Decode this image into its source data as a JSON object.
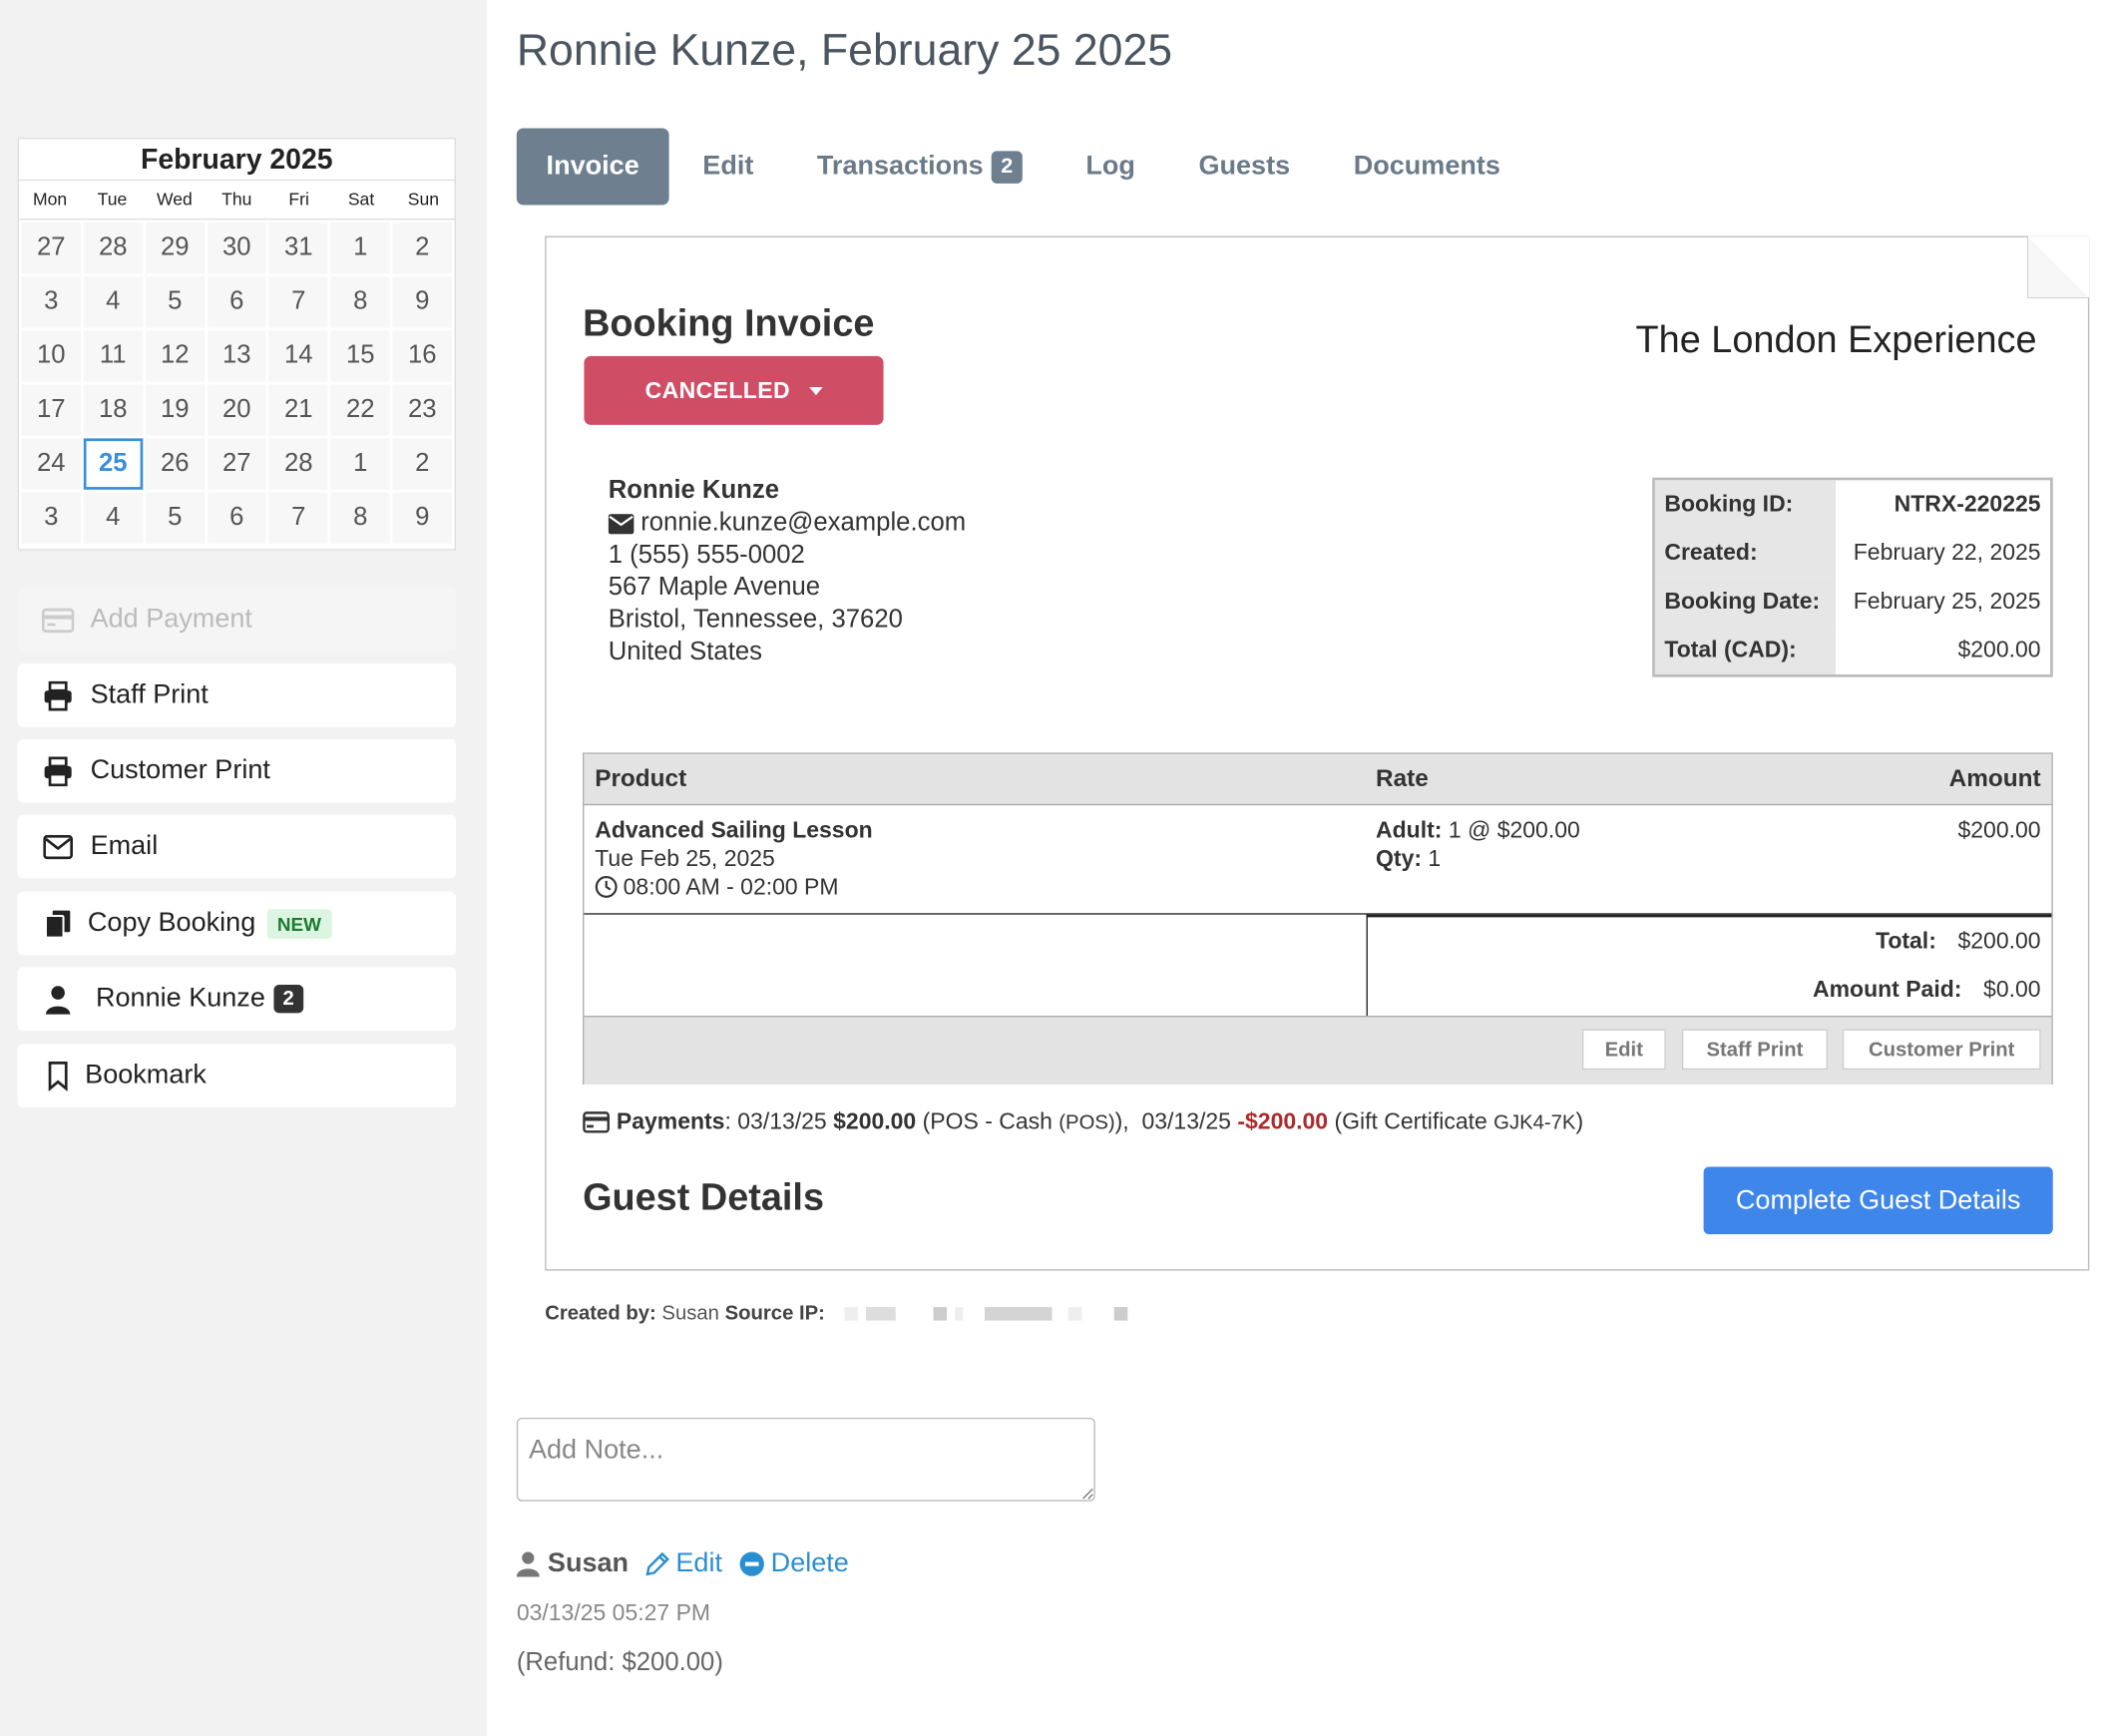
{
  "calendar": {
    "month_label": "February 2025",
    "weekdays": [
      "Mon",
      "Tue",
      "Wed",
      "Thu",
      "Fri",
      "Sat",
      "Sun"
    ],
    "days": [
      "27",
      "28",
      "29",
      "30",
      "31",
      "1",
      "2",
      "3",
      "4",
      "5",
      "6",
      "7",
      "8",
      "9",
      "10",
      "11",
      "12",
      "13",
      "14",
      "15",
      "16",
      "17",
      "18",
      "19",
      "20",
      "21",
      "22",
      "23",
      "24",
      "25",
      "26",
      "27",
      "28",
      "1",
      "2",
      "3",
      "4",
      "5",
      "6",
      "7",
      "8",
      "9"
    ],
    "selected_day": "25"
  },
  "sidebar": {
    "add_payment": "Add Payment",
    "staff_print": "Staff Print",
    "customer_print": "Customer Print",
    "email": "Email",
    "copy_booking": "Copy Booking",
    "copy_booking_badge": "NEW",
    "customer_name": "Ronnie Kunze",
    "customer_badge": "2",
    "bookmark": "Bookmark"
  },
  "page": {
    "title": "Ronnie Kunze, February 25 2025"
  },
  "tabs": [
    {
      "label": "Invoice",
      "active": true
    },
    {
      "label": "Edit"
    },
    {
      "label": "Transactions",
      "badge": "2"
    },
    {
      "label": "Log"
    },
    {
      "label": "Guests"
    },
    {
      "label": "Documents"
    }
  ],
  "invoice": {
    "title": "Booking Invoice",
    "status": "CANCELLED",
    "company": "The London Experience",
    "customer": {
      "name": "Ronnie Kunze",
      "email": "ronnie.kunze@example.com",
      "phone": "1 (555) 555-0002",
      "street": "567 Maple Avenue",
      "city": "Bristol, Tennessee, 37620",
      "country": "United States"
    },
    "meta": {
      "booking_id_label": "Booking ID:",
      "booking_id": "NTRX-220225",
      "created_label": "Created:",
      "created": "February 22, 2025",
      "booking_date_label": "Booking Date:",
      "booking_date": "February 25, 2025",
      "total_label": "Total (CAD):",
      "total": "$200.00"
    },
    "table": {
      "headers": {
        "product": "Product",
        "rate": "Rate",
        "amount": "Amount"
      },
      "line": {
        "product": "Advanced Sailing Lesson",
        "date": "Tue Feb 25, 2025",
        "time": "08:00 AM - 02:00 PM",
        "rate_label": "Adult:",
        "rate_value": "1 @ $200.00",
        "qty_label": "Qty:",
        "qty_value": "1",
        "amount": "$200.00"
      },
      "total_label": "Total:",
      "total": "$200.00",
      "paid_label": "Amount Paid:",
      "paid": "$0.00",
      "buttons": {
        "edit": "Edit",
        "staff_print": "Staff Print",
        "customer_print": "Customer Print"
      }
    },
    "payments": {
      "label": "Payments",
      "p1_date": "03/13/25",
      "p1_amount": "$200.00",
      "p1_method": "(POS - Cash",
      "p1_code": "(POS)",
      "p1_close": "),",
      "p2_date": "03/13/25",
      "p2_amount": "-$200.00",
      "p2_method": "(Gift Certificate",
      "p2_code": "GJK4-7K",
      "p2_close": ")"
    },
    "guest_details_title": "Guest Details",
    "complete_guest_button": "Complete Guest Details"
  },
  "created_by": {
    "label": "Created by:",
    "user": "Susan",
    "ip_label": "Source IP:"
  },
  "notes": {
    "placeholder": "Add Note...",
    "author": "Susan",
    "edit": "Edit",
    "delete": "Delete",
    "timestamp": "03/13/25 05:27 PM",
    "text": "(Refund: $200.00)"
  },
  "colors": {
    "status_cancelled": "#d04d66",
    "primary": "#3f86ea",
    "tab_active": "#6e7f90",
    "link": "#2a8fd1"
  }
}
